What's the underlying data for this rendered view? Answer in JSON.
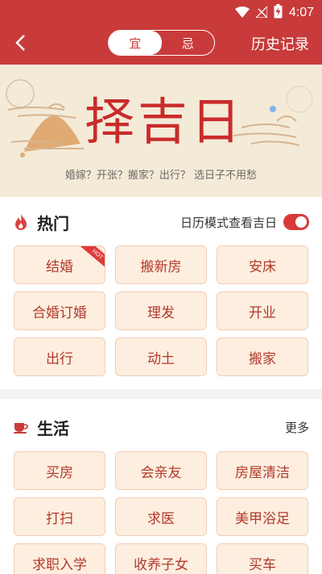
{
  "status": {
    "time": "4:07"
  },
  "nav": {
    "segments": [
      {
        "label": "宜",
        "active": true
      },
      {
        "label": "忌",
        "active": false
      }
    ],
    "history_label": "历史记录"
  },
  "banner": {
    "title": "择吉日",
    "subtitle": "婚嫁？开张？搬家？出行？ 选日子不用愁"
  },
  "hot": {
    "title": "热门",
    "toggle_label": "日历模式查看吉日",
    "toggle_on": true,
    "items": [
      {
        "label": "结婚",
        "badge": "HOT"
      },
      {
        "label": "搬新房"
      },
      {
        "label": "安床"
      },
      {
        "label": "合婚订婚"
      },
      {
        "label": "理发"
      },
      {
        "label": "开业"
      },
      {
        "label": "出行"
      },
      {
        "label": "动土"
      },
      {
        "label": "搬家"
      }
    ]
  },
  "life": {
    "title": "生活",
    "more_label": "更多",
    "items": [
      {
        "label": "买房"
      },
      {
        "label": "会亲友"
      },
      {
        "label": "房屋清洁"
      },
      {
        "label": "打扫"
      },
      {
        "label": "求医"
      },
      {
        "label": "美甲浴足"
      },
      {
        "label": "求职入学"
      },
      {
        "label": "收养子女"
      },
      {
        "label": "买车"
      }
    ]
  },
  "colors": {
    "brand_red": "#c93a3a",
    "tag_bg": "#fdeedf",
    "tag_text": "#b33a2c"
  }
}
